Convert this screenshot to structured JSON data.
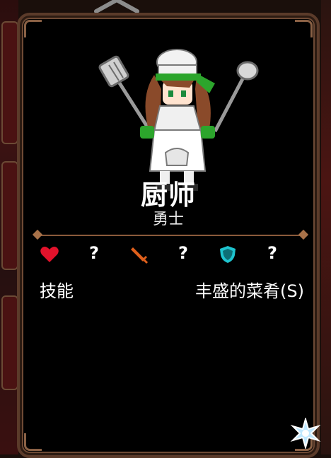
{
  "hero": {
    "name": "厨师",
    "job": "勇士"
  },
  "stats": {
    "hp": "?",
    "attack": "?",
    "defense": "?"
  },
  "skill": {
    "label": "技能",
    "name": "丰盛的菜肴(S)"
  },
  "colors": {
    "heart": "#e3122b",
    "sword": "#e0601c",
    "shield": "#1ec4cf",
    "frame": "#5b3b2a"
  }
}
